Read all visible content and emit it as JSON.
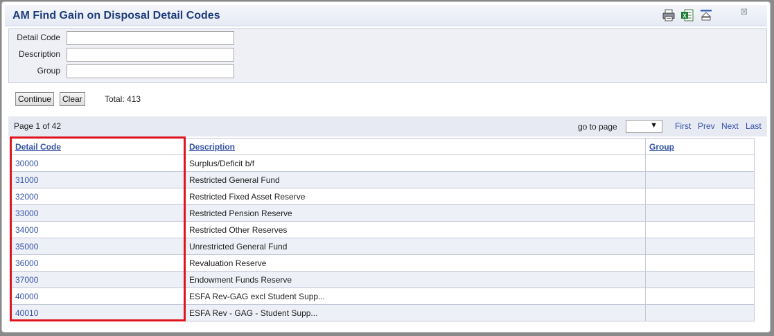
{
  "window": {
    "title": "AM Find Gain on Disposal Detail Codes",
    "icons": [
      "print-icon",
      "excel-export-icon",
      "collapse-icon",
      "close-icon"
    ]
  },
  "criteria": {
    "detail_code_label": "Detail Code",
    "detail_code_value": "",
    "description_label": "Description",
    "description_value": "",
    "group_label": "Group",
    "group_value": ""
  },
  "actions": {
    "continue_label": "Continue",
    "clear_label": "Clear",
    "total_text": "Total: 413"
  },
  "pager": {
    "page_info": "Page 1 of 42",
    "goto_label": "go to page",
    "goto_value": "",
    "first": "First",
    "prev": "Prev",
    "next": "Next",
    "last": "Last"
  },
  "table": {
    "columns": [
      "Detail Code",
      "Description",
      "Group"
    ],
    "rows": [
      {
        "code": "30000",
        "description": "Surplus/Deficit b/f",
        "group": ""
      },
      {
        "code": "31000",
        "description": "Restricted General Fund",
        "group": ""
      },
      {
        "code": "32000",
        "description": "Restricted Fixed Asset Reserve",
        "group": ""
      },
      {
        "code": "33000",
        "description": "Restricted Pension Reserve",
        "group": ""
      },
      {
        "code": "34000",
        "description": "Restricted Other Reserves",
        "group": ""
      },
      {
        "code": "35000",
        "description": "Unrestricted General Fund",
        "group": ""
      },
      {
        "code": "36000",
        "description": "Revaluation Reserve",
        "group": ""
      },
      {
        "code": "37000",
        "description": "Endowment Funds Reserve",
        "group": ""
      },
      {
        "code": "40000",
        "description": "ESFA Rev-GAG excl Student Supp...",
        "group": ""
      },
      {
        "code": "40010",
        "description": "ESFA Rev - GAG - Student Supp...",
        "group": ""
      }
    ]
  },
  "colors": {
    "title": "#1d3b7a",
    "link": "#3452a4",
    "highlight": "#e0141e"
  }
}
